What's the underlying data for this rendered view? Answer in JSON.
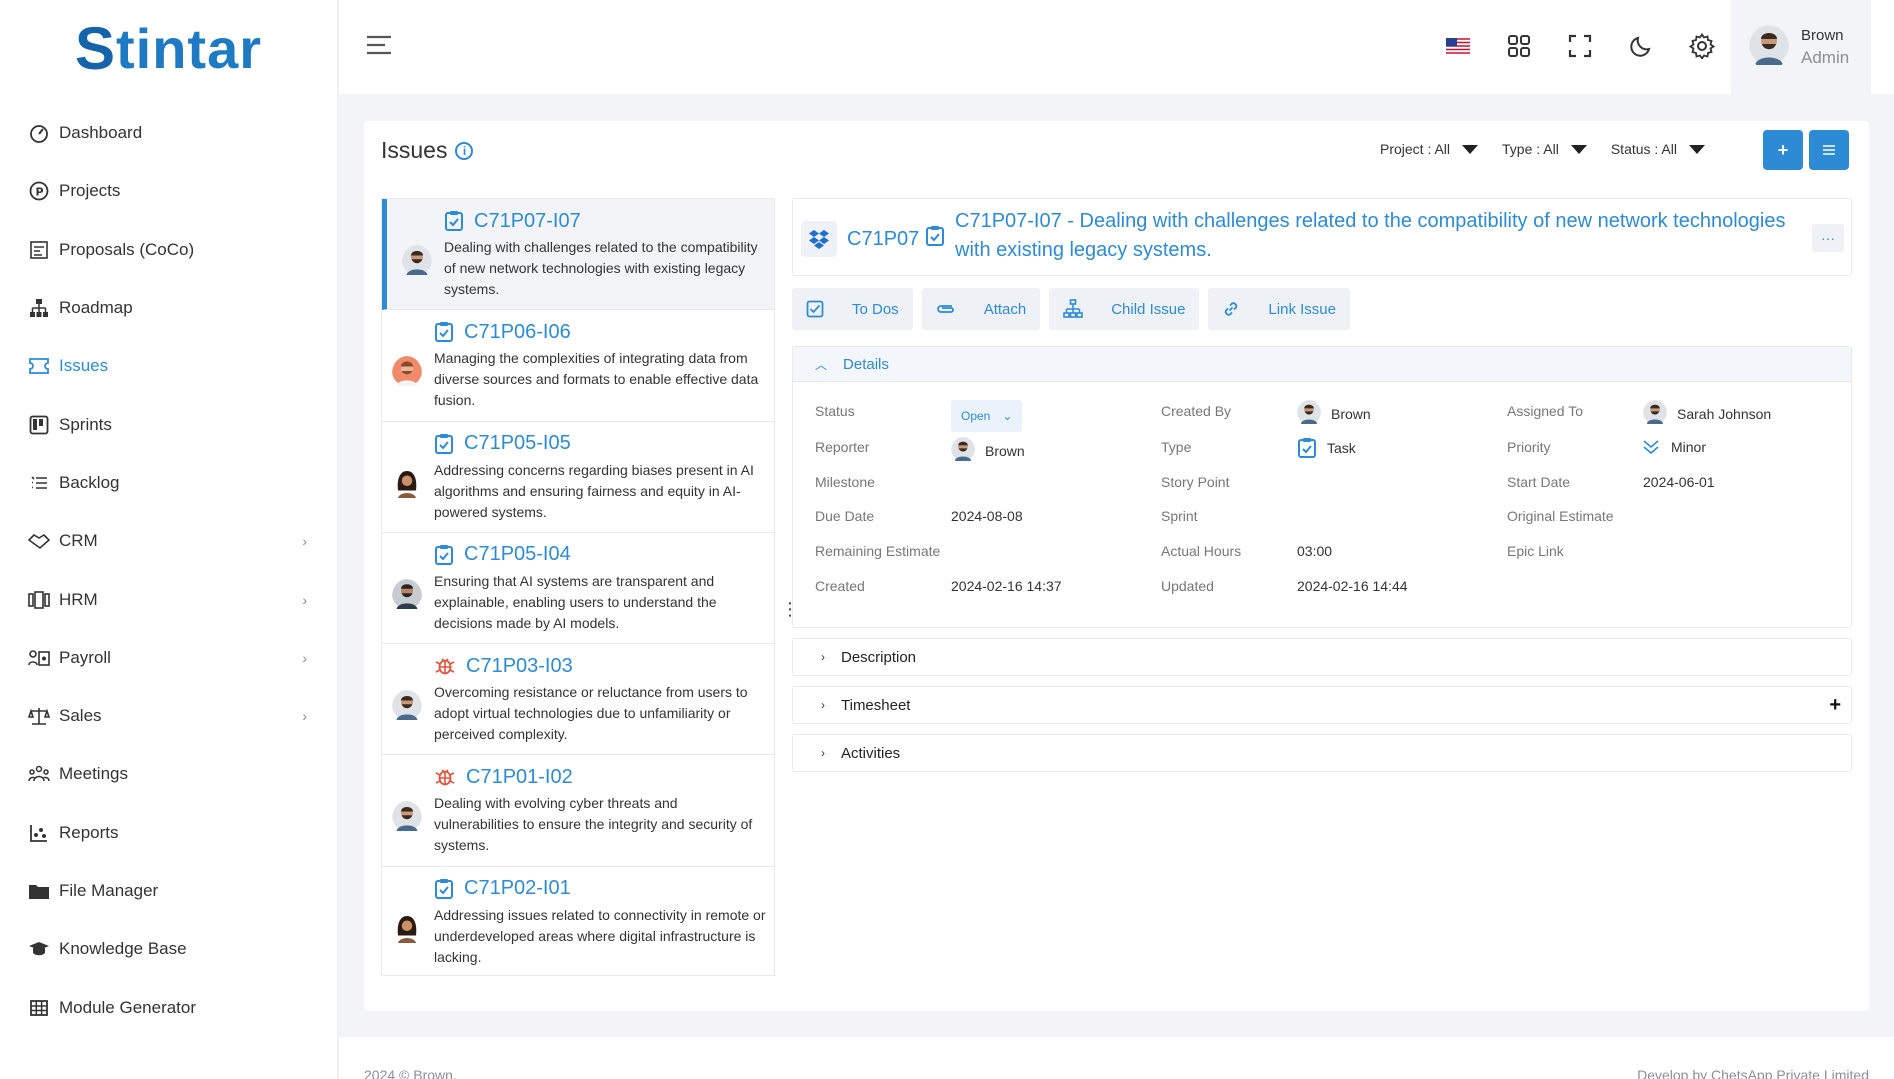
{
  "app": {
    "logo_text": "tintar",
    "logo_letter": "S"
  },
  "sidebar": {
    "items": [
      {
        "label": "Dashboard",
        "icon": "gauge-icon"
      },
      {
        "label": "Projects",
        "icon": "p-circle-icon"
      },
      {
        "label": "Proposals (CoCo)",
        "icon": "proposal-icon"
      },
      {
        "label": "Roadmap",
        "icon": "sitemap-icon"
      },
      {
        "label": "Issues",
        "icon": "ticket-icon",
        "active": true
      },
      {
        "label": "Sprints",
        "icon": "kanban-icon"
      },
      {
        "label": "Backlog",
        "icon": "list-icon"
      },
      {
        "label": "CRM",
        "icon": "handshake-icon",
        "chevron": true
      },
      {
        "label": "HRM",
        "icon": "people-icon",
        "chevron": true
      },
      {
        "label": "Payroll",
        "icon": "payroll-icon",
        "chevron": true
      },
      {
        "label": "Sales",
        "icon": "scale-icon",
        "chevron": true
      },
      {
        "label": "Meetings",
        "icon": "meeting-icon"
      },
      {
        "label": "Reports",
        "icon": "chart-icon"
      },
      {
        "label": "File Manager",
        "icon": "folder-icon"
      },
      {
        "label": "Knowledge Base",
        "icon": "graduation-icon"
      },
      {
        "label": "Module Generator",
        "icon": "table-icon"
      }
    ]
  },
  "user": {
    "name": "Brown",
    "role": "Admin"
  },
  "page": {
    "title": "Issues",
    "filters": {
      "project": "Project : All",
      "type": "Type : All",
      "status": "Status : All"
    }
  },
  "issues": [
    {
      "code": "C71P07-I07",
      "type": "task",
      "desc": "Dealing with challenges related to the compatibility of new network technologies with existing legacy systems.",
      "avatar": "man1"
    },
    {
      "code": "C71P06-I06",
      "type": "task",
      "desc": "Managing the complexities of integrating data from diverse sources and formats to enable effective data fusion.",
      "avatar": "man2"
    },
    {
      "code": "C71P05-I05",
      "type": "task",
      "desc": "Addressing concerns regarding biases present in AI algorithms and ensuring fairness and equity in AI-powered systems.",
      "avatar": "woman"
    },
    {
      "code": "C71P05-I04",
      "type": "task",
      "desc": "Ensuring that AI systems are transparent and explainable, enabling users to understand the decisions made by AI models.",
      "avatar": "man3"
    },
    {
      "code": "C71P03-I03",
      "type": "bug",
      "desc": "Overcoming resistance or reluctance from users to adopt virtual technologies due to unfamiliarity or perceived complexity.",
      "avatar": "man1"
    },
    {
      "code": "C71P01-I02",
      "type": "bug",
      "desc": "Dealing with evolving cyber threats and vulnerabilities to ensure the integrity and security of systems.",
      "avatar": "man1"
    },
    {
      "code": "C71P02-I01",
      "type": "task",
      "desc": "Addressing issues related to connectivity in remote or underdeveloped areas where digital infrastructure is lacking.",
      "avatar": "woman"
    }
  ],
  "detail": {
    "project": "C71P07",
    "title": "C71P07-I07 - Dealing with challenges related to the compatibility of new network technologies with existing legacy systems.",
    "more": "···",
    "actions": [
      "To Dos",
      "Attach",
      "Child Issue",
      "Link Issue"
    ],
    "section": "Details",
    "labels": {
      "status": "Status",
      "reporter": "Reporter",
      "milestone": "Milestone",
      "due_date": "Due Date",
      "remaining": "Remaining Estimate",
      "created": "Created",
      "created_by": "Created By",
      "type": "Type",
      "story_point": "Story Point",
      "sprint": "Sprint",
      "actual_hours": "Actual Hours",
      "updated": "Updated",
      "assigned_to": "Assigned To",
      "priority": "Priority",
      "start_date": "Start Date",
      "original_estimate": "Original Estimate",
      "epic_link": "Epic Link"
    },
    "values": {
      "status": "Open",
      "reporter": "Brown",
      "due_date": "2024-08-08",
      "created": "2024-02-16 14:37",
      "created_by": "Brown",
      "type": "Task",
      "actual_hours": "03:00",
      "updated": "2024-02-16 14:44",
      "assigned_to": "Sarah Johnson",
      "priority": "Minor",
      "start_date": "2024-06-01"
    },
    "accordions": [
      "Description",
      "Timesheet",
      "Activities"
    ]
  },
  "footer": {
    "left": "2024 © Brown.",
    "right": "Develop by ChetsApp Private Limited"
  },
  "colors": {
    "accent": "#2d8bd6",
    "bug": "#e0533d"
  }
}
